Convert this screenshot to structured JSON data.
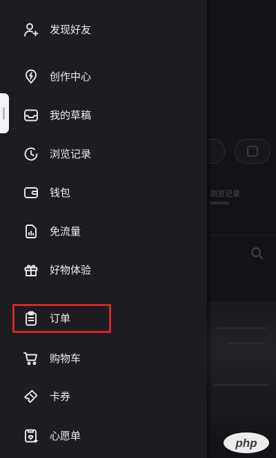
{
  "background_app": {
    "partial_text": "浏览记录"
  },
  "menu": {
    "items": [
      {
        "id": "add-friend",
        "label": "发现好友",
        "icon": "user-plus-icon"
      },
      {
        "id": "creator-center",
        "label": "创作中心",
        "icon": "lightbulb-icon"
      },
      {
        "id": "drafts",
        "label": "我的草稿",
        "icon": "inbox-icon"
      },
      {
        "id": "history",
        "label": "浏览记录",
        "icon": "clock-icon"
      },
      {
        "id": "wallet",
        "label": "钱包",
        "icon": "wallet-icon"
      },
      {
        "id": "free-data",
        "label": "免流量",
        "icon": "data-file-icon"
      },
      {
        "id": "goods-trial",
        "label": "好物体验",
        "icon": "gift-icon"
      },
      {
        "id": "orders",
        "label": "订单",
        "icon": "clipboard-icon",
        "highlighted": true
      },
      {
        "id": "cart",
        "label": "购物车",
        "icon": "cart-icon"
      },
      {
        "id": "coupons",
        "label": "卡券",
        "icon": "ticket-icon"
      },
      {
        "id": "wishlist",
        "label": "心愿单",
        "icon": "wishlist-icon"
      }
    ]
  },
  "watermark": {
    "text": "php",
    "icon": "php-logo-icon"
  },
  "colors": {
    "drawer_bg": "#1c1c21",
    "text": "#ececf0",
    "highlight": "#d9232b"
  }
}
